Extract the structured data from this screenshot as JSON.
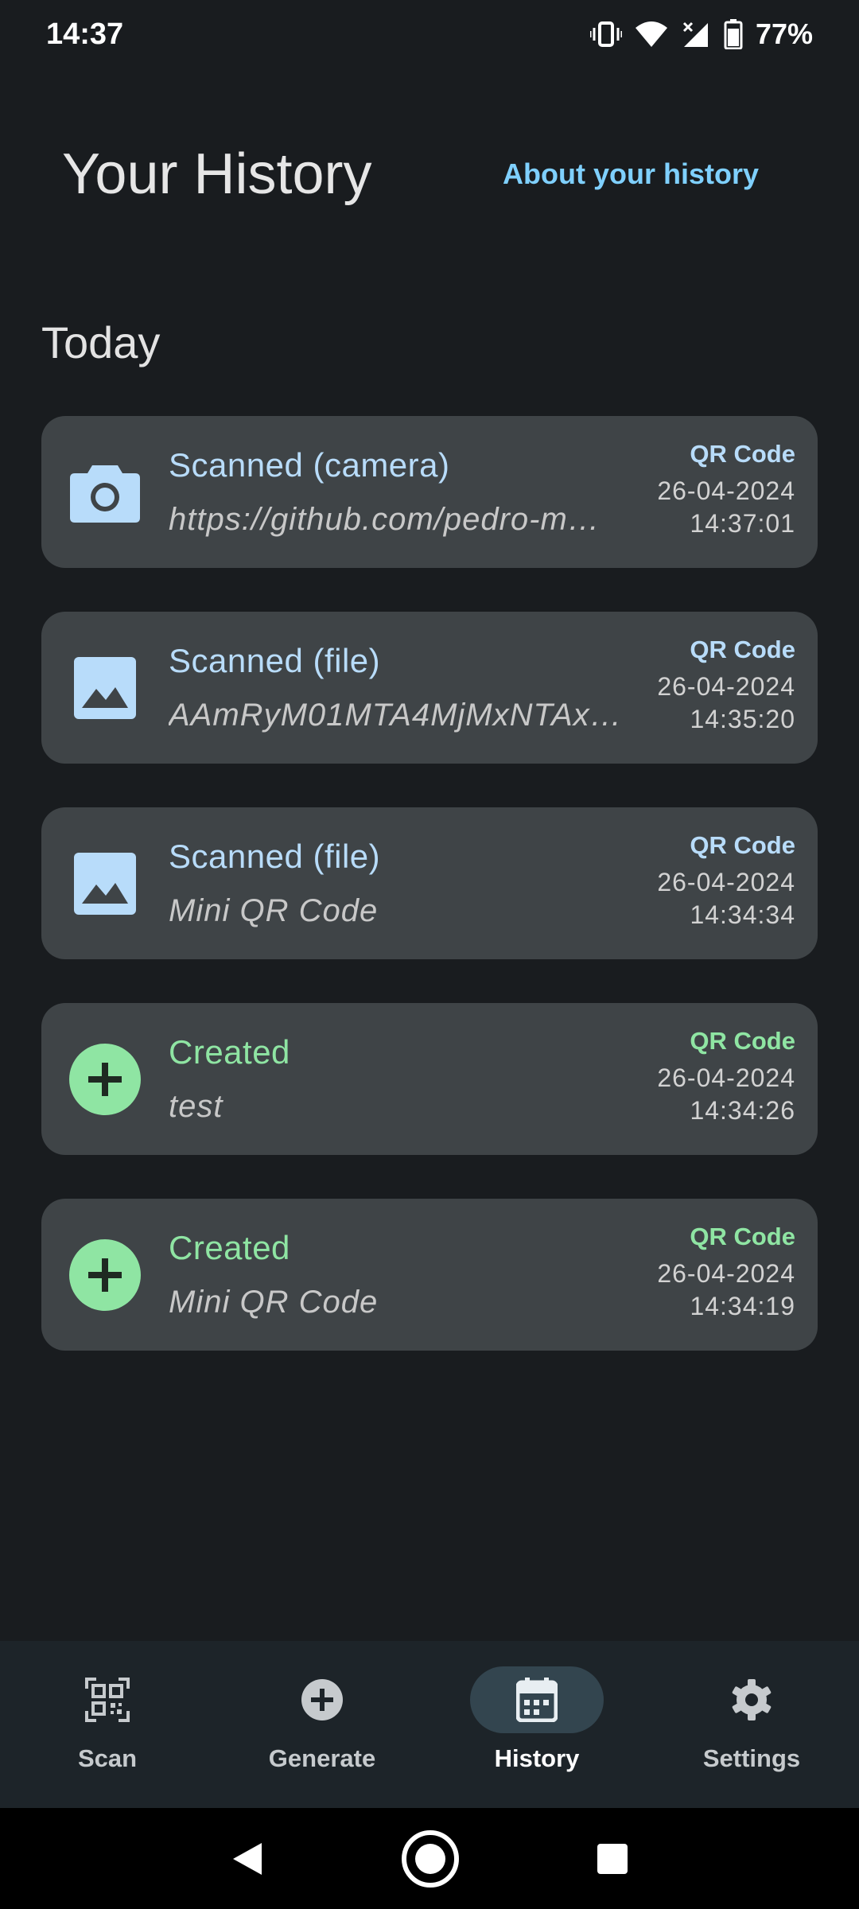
{
  "status_bar": {
    "time": "14:37",
    "battery_percent": "77%",
    "icons": [
      "vibrate-icon",
      "wifi-icon",
      "cell-signal-icon",
      "battery-icon"
    ]
  },
  "header": {
    "title": "Your History",
    "about_link": "About your history"
  },
  "section": {
    "label": "Today"
  },
  "history_items": [
    {
      "kind": "scanned",
      "icon": "camera-icon",
      "title": "Scanned (camera)",
      "content": "https://github.com/pedro-m…",
      "type": "QR Code",
      "date": "26-04-2024",
      "time": "14:37:01"
    },
    {
      "kind": "scanned",
      "icon": "image-icon",
      "title": "Scanned (file)",
      "content": "AAmRyM01MTA4MjMxNTAx…",
      "type": "QR Code",
      "date": "26-04-2024",
      "time": "14:35:20"
    },
    {
      "kind": "scanned",
      "icon": "image-icon",
      "title": "Scanned (file)",
      "content": "Mini QR Code",
      "type": "QR Code",
      "date": "26-04-2024",
      "time": "14:34:34"
    },
    {
      "kind": "created",
      "icon": "plus-icon",
      "title": "Created",
      "content": "test",
      "type": "QR Code",
      "date": "26-04-2024",
      "time": "14:34:26"
    },
    {
      "kind": "created",
      "icon": "plus-icon",
      "title": "Created",
      "content": "Mini QR Code",
      "type": "QR Code",
      "date": "26-04-2024",
      "time": "14:34:19"
    }
  ],
  "bottom_nav": {
    "items": [
      {
        "label": "Scan",
        "icon": "qr-scan-icon",
        "active": false
      },
      {
        "label": "Generate",
        "icon": "add-circle-icon",
        "active": false
      },
      {
        "label": "History",
        "icon": "calendar-icon",
        "active": true
      },
      {
        "label": "Settings",
        "icon": "gear-icon",
        "active": false
      }
    ]
  },
  "colors": {
    "background": "#191c1f",
    "card": "#3f4447",
    "scanned_accent": "#b8dcfa",
    "created_accent": "#8fe5a3",
    "link": "#7fd0ff"
  }
}
